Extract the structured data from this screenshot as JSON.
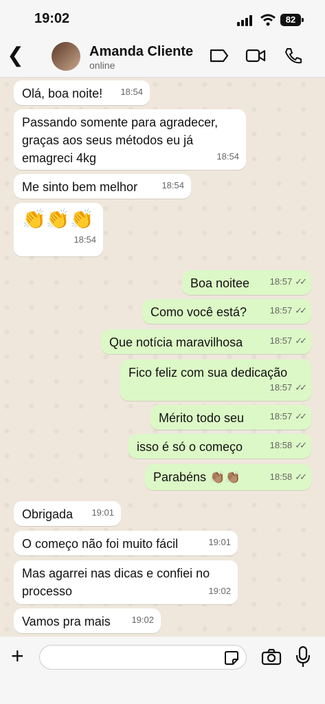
{
  "status_bar": {
    "time": "19:02",
    "battery": "82"
  },
  "header": {
    "back_icon": "chevron-left-icon",
    "contact_name": "Amanda Cliente",
    "contact_status": "online",
    "icons": [
      "tag-icon",
      "video-call-icon",
      "phone-icon"
    ]
  },
  "messages": [
    {
      "dir": "in",
      "text": "Olá, boa noite!",
      "time": "18:54"
    },
    {
      "dir": "in",
      "text": "Passando somente para agradecer,\ngraças aos seus métodos eu já\nemagreci 4kg",
      "time": "18:54"
    },
    {
      "dir": "in",
      "text": "Me sinto bem melhor",
      "time": "18:54"
    },
    {
      "dir": "in",
      "text": "👏👏👏",
      "time": "18:54"
    },
    {
      "dir": "out",
      "text": "Boa noitee",
      "time": "18:57"
    },
    {
      "dir": "out",
      "text": "Como você está?",
      "time": "18:57"
    },
    {
      "dir": "out",
      "text": "Que notícia maravilhosa",
      "time": "18:57"
    },
    {
      "dir": "out",
      "text": "Fico feliz com sua dedicação",
      "time": "18:57"
    },
    {
      "dir": "out",
      "text": "Mérito todo seu",
      "time": "18:57"
    },
    {
      "dir": "out",
      "text": "isso é só o começo",
      "time": "18:58"
    },
    {
      "dir": "out",
      "text": "Parabéns 👏🏽👏🏽",
      "time": "18:58"
    },
    {
      "dir": "in",
      "text": "Obrigada",
      "time": "19:01"
    },
    {
      "dir": "in",
      "text": "O começo não foi muito fácil",
      "time": "19:01"
    },
    {
      "dir": "in",
      "text": "Mas agarrei nas dicas e confiei no\nprocesso",
      "time": "19:02"
    },
    {
      "dir": "in",
      "text": "Vamos pra mais",
      "time": "19:02"
    }
  ],
  "composer": {
    "placeholder": "",
    "icons": [
      "plus-icon",
      "sticker-icon",
      "camera-icon",
      "microphone-icon"
    ]
  },
  "colors": {
    "incoming": "#ffffff",
    "outgoing": "#dcf8c6",
    "background": "#efe7dc"
  }
}
